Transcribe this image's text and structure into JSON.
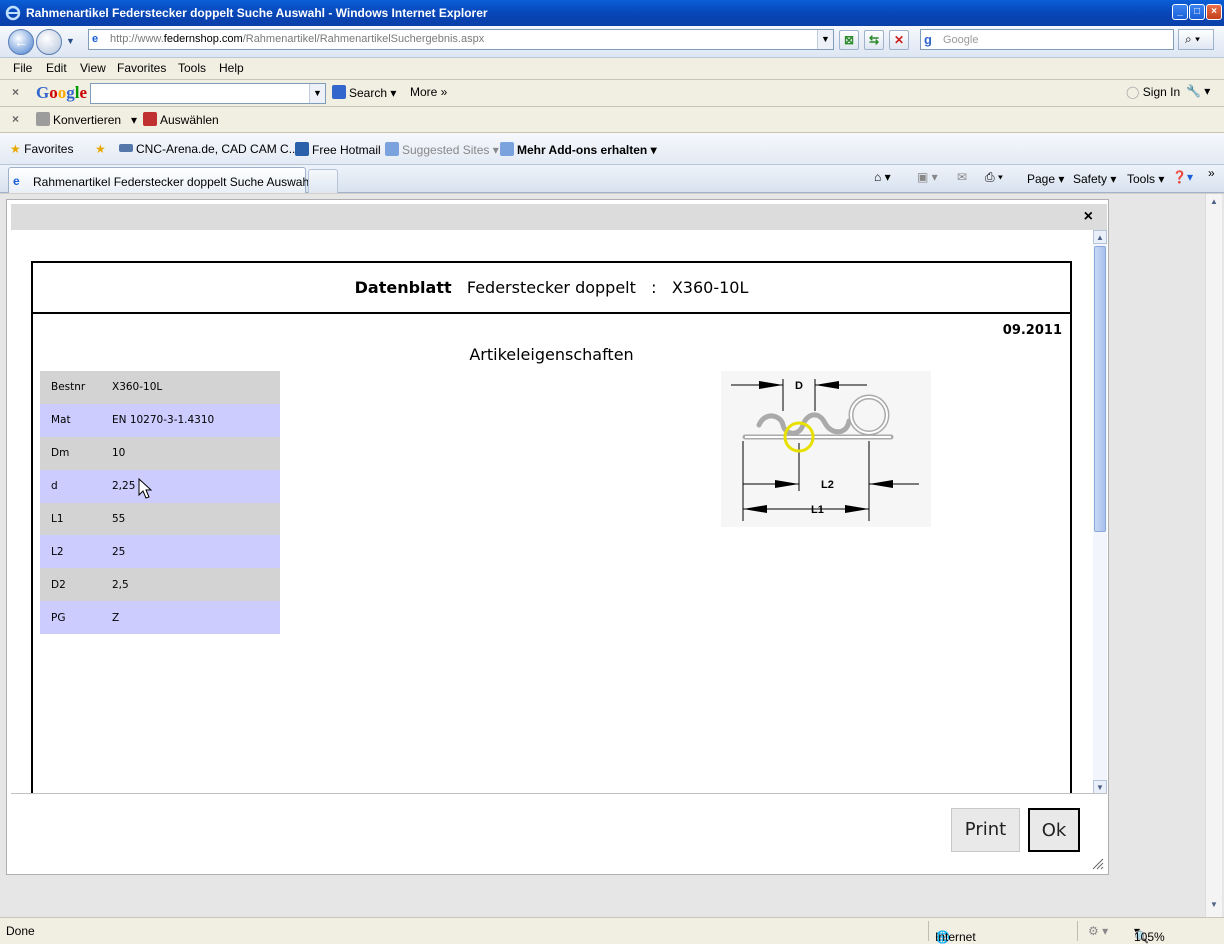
{
  "window": {
    "title": "Rahmenartikel Federstecker doppelt Suche Auswahl - Windows Internet Explorer"
  },
  "address": {
    "url_prefix": "http://www.",
    "url_domain": "federnshop.com",
    "url_path": "/Rahmenartikel/RahmenartikelSuchergebnis.aspx"
  },
  "search": {
    "placeholder": "Google"
  },
  "menu": [
    "File",
    "Edit",
    "View",
    "Favorites",
    "Tools",
    "Help"
  ],
  "google_toolbar": {
    "search_label": "Search",
    "more_label": "More",
    "sign_in": "Sign In"
  },
  "convert_toolbar": {
    "convert": "Konvertieren",
    "select": "Auswählen"
  },
  "favorites_bar": {
    "favorites": "Favorites",
    "items": [
      "CNC-Arena.de, CAD CAM C...",
      "Free Hotmail",
      "Suggested Sites",
      "Mehr Add-ons erhalten"
    ]
  },
  "tab": {
    "label": "Rahmenartikel Federstecker doppelt Suche Auswahl"
  },
  "command_bar": {
    "page": "Page",
    "safety": "Safety",
    "tools": "Tools"
  },
  "sheet": {
    "header_bold": "Datenblatt",
    "header_title": "Federstecker doppelt",
    "header_sep": ":",
    "header_code": "X360-10L",
    "date": "09.2011",
    "section": "Artikeleigenschaften",
    "properties": [
      {
        "key": "Bestnr",
        "value": "X360-10L"
      },
      {
        "key": "Mat",
        "value": "EN 10270-3-1.4310"
      },
      {
        "key": "Dm",
        "value": "10"
      },
      {
        "key": "d",
        "value": "2,25"
      },
      {
        "key": "L1",
        "value": "55"
      },
      {
        "key": "L2",
        "value": "25"
      },
      {
        "key": "D2",
        "value": "2,5"
      },
      {
        "key": "PG",
        "value": "Z"
      }
    ],
    "drawing_labels": {
      "d": "D",
      "l2": "L2",
      "l1": "L1"
    }
  },
  "dialog": {
    "print_label": "Print",
    "ok_label": "Ok"
  },
  "status": {
    "left": "Done",
    "zone": "Internet",
    "zoom": "105%"
  },
  "colors": {
    "row_gray": "#d3d3d3",
    "row_blue": "#ccccff",
    "titlebar": "#0846b8"
  }
}
